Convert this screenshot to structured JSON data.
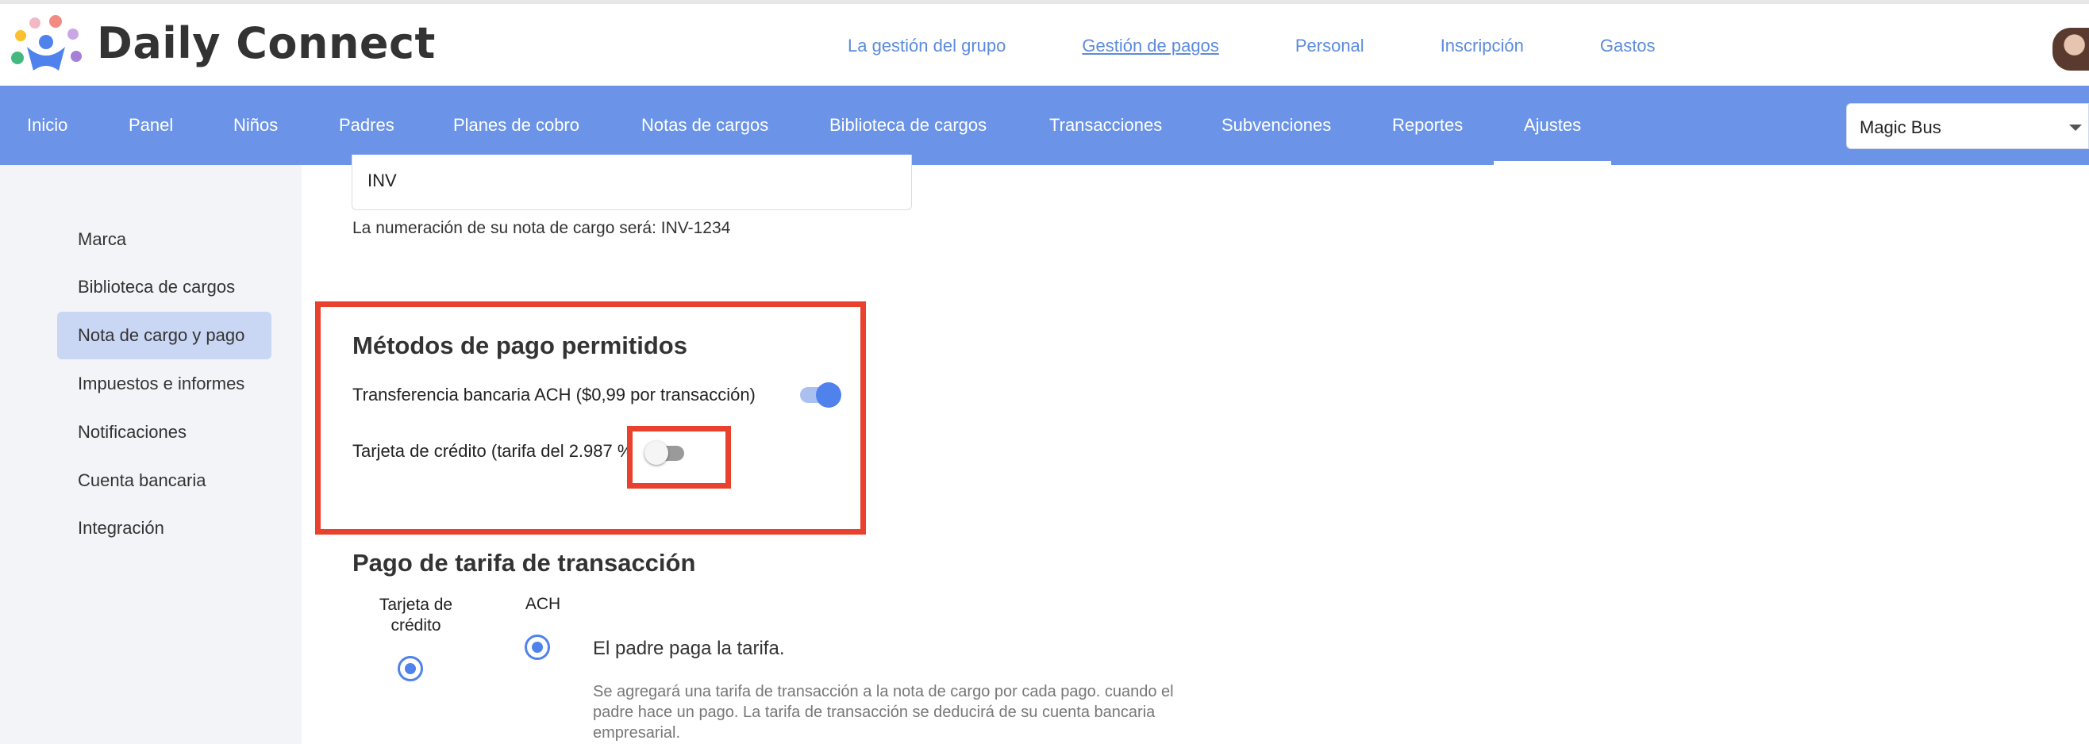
{
  "app": {
    "title": "Daily Connect",
    "logo_icon": "people-connect-logo-icon"
  },
  "top_nav": {
    "items": [
      {
        "label": "La gestión del grupo",
        "active": false
      },
      {
        "label": "Gestión de pagos",
        "active": true
      },
      {
        "label": "Personal",
        "active": false
      },
      {
        "label": "Inscripción",
        "active": false
      },
      {
        "label": "Gastos",
        "active": false
      }
    ]
  },
  "main_nav": {
    "items": [
      {
        "label": "Inicio"
      },
      {
        "label": "Panel"
      },
      {
        "label": "Niños"
      },
      {
        "label": "Padres"
      },
      {
        "label": "Planes de cobro"
      },
      {
        "label": "Notas de cargos"
      },
      {
        "label": "Biblioteca de cargos"
      },
      {
        "label": "Transacciones"
      },
      {
        "label": "Subvenciones"
      },
      {
        "label": "Reportes"
      },
      {
        "label": "Ajustes",
        "active": true
      }
    ],
    "center_select": {
      "value": "Magic Bus"
    }
  },
  "sidebar": {
    "items": [
      {
        "label": "Marca"
      },
      {
        "label": "Biblioteca de cargos"
      },
      {
        "label": "Nota de cargo y pago",
        "active": true
      },
      {
        "label": "Impuestos e informes"
      },
      {
        "label": "Notificaciones"
      },
      {
        "label": "Cuenta bancaria"
      },
      {
        "label": "Integración"
      }
    ]
  },
  "invoice": {
    "prefix_value": "INV",
    "numbering_note": "La numeración de su nota de cargo será: INV-1234"
  },
  "payment_methods": {
    "title": "Métodos de pago permitidos",
    "ach_label": "Transferencia bancaria ACH ($0,99 por transacción)",
    "ach_enabled": true,
    "card_label": "Tarjeta de crédito (tarifa del 2.987 %",
    "card_enabled": false
  },
  "transaction_fee": {
    "title": "Pago de tarifa de transacción",
    "col_card": "Tarjeta de crédito",
    "col_ach": "ACH",
    "option_title": "El padre paga la tarifa.",
    "option_desc": "Se agregará una tarifa de transacción a la nota de cargo por cada pago. cuando el padre hace un pago. La tarifa de transacción se deducirá de su cuenta bancaria empresarial."
  },
  "colors": {
    "accent": "#6b94e8",
    "toggle_on": "#4f82ec",
    "highlight": "#e8412e",
    "sidebar_active": "#c9d6f4"
  }
}
